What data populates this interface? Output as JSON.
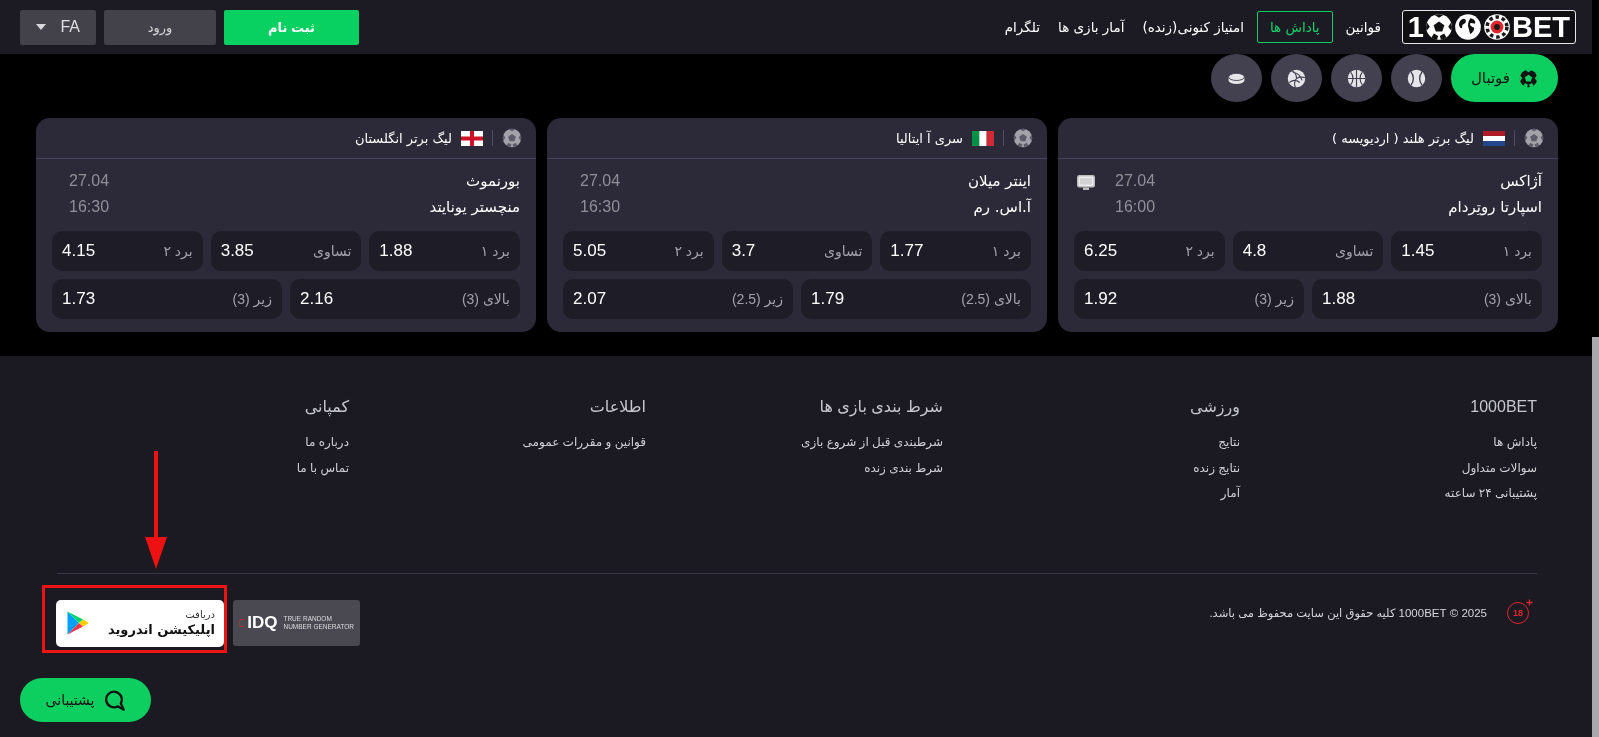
{
  "header": {
    "logo": {
      "lead": "1",
      "tail": "BET"
    },
    "nav": [
      {
        "label": "قوانین",
        "selected": false
      },
      {
        "label": "پاداش ها",
        "selected": true
      },
      {
        "label": "امتیاز کنونی(زنده)",
        "selected": false
      },
      {
        "label": "آمار بازی ها",
        "selected": false
      },
      {
        "label": "تلگرام",
        "selected": false
      }
    ],
    "register": "ثبت نام",
    "login": "ورود",
    "language": "FA"
  },
  "sports": [
    {
      "kind": "football",
      "label": "فوتبال",
      "selected": true
    },
    {
      "kind": "tennis",
      "selected": false
    },
    {
      "kind": "basketball",
      "selected": false
    },
    {
      "kind": "volleyball",
      "selected": false
    },
    {
      "kind": "hockey",
      "selected": false
    }
  ],
  "matches": [
    {
      "league": "لیگ برتر هلند ( اردیویسه )",
      "flag": {
        "kind": "netherlands"
      },
      "teams": [
        "آژاکس",
        "اسپارتا روتِردام"
      ],
      "date": "27.04",
      "time": "16:00",
      "tv": true,
      "odds": [
        {
          "label": "برد ۱",
          "value": "1.45"
        },
        {
          "label": "تساوی",
          "value": "4.8"
        },
        {
          "label": "برد ۲",
          "value": "6.25"
        }
      ],
      "totals": [
        {
          "label": "بالای (3)",
          "value": "1.88"
        },
        {
          "label": "زیر (3)",
          "value": "1.92"
        }
      ]
    },
    {
      "league": "سری آ ایتالیا",
      "flag": {
        "kind": "italy"
      },
      "teams": [
        "اینتر میلان",
        "آ.اس. رم"
      ],
      "date": "27.04",
      "time": "16:30",
      "tv": false,
      "odds": [
        {
          "label": "برد ۱",
          "value": "1.77"
        },
        {
          "label": "تساوی",
          "value": "3.7"
        },
        {
          "label": "برد ۲",
          "value": "5.05"
        }
      ],
      "totals": [
        {
          "label": "بالای (2.5)",
          "value": "1.79"
        },
        {
          "label": "زیر (2.5)",
          "value": "2.07"
        }
      ]
    },
    {
      "league": "لیگ برتر انگلستان",
      "flag": {
        "kind": "england"
      },
      "teams": [
        "بورنموث",
        "منچستر یونایتد"
      ],
      "date": "27.04",
      "time": "16:30",
      "tv": false,
      "odds": [
        {
          "label": "برد ۱",
          "value": "1.88"
        },
        {
          "label": "تساوی",
          "value": "3.85"
        },
        {
          "label": "برد ۲",
          "value": "4.15"
        }
      ],
      "totals": [
        {
          "label": "بالای (3)",
          "value": "2.16"
        },
        {
          "label": "زیر (3)",
          "value": "1.73"
        }
      ]
    }
  ],
  "footer": {
    "columns": [
      {
        "title": "1000BET",
        "links": [
          "پاداش ها",
          "سوالات متداول",
          "پشتیبانی ۲۴ ساعته"
        ]
      },
      {
        "title": "ورزشی",
        "links": [
          "نتایج",
          "نتایج زنده",
          "آمار"
        ]
      },
      {
        "title": "شرط بندی بازی ها",
        "links": [
          "شرطبندی قبل از شروع بازی",
          "شرط بندی زنده"
        ]
      },
      {
        "title": "اطلاعات",
        "links": [
          "قوانین و مقررات عمومی"
        ]
      },
      {
        "title": "کمپانی",
        "links": [
          "درباره ما",
          "تماس با ما"
        ]
      }
    ],
    "app_badge": {
      "caption": "دریافت",
      "title": "اپلیکیشن اندروید"
    },
    "rng_badge": {
      "brand": "IDQ",
      "caption": [
        "TRUE RANDOM",
        "NUMBER GENERATOR"
      ]
    },
    "age_limit": "18",
    "copyright": "2025 © 1000BET کلیه حقوق این سایت محفوظ می باشد.",
    "support": "پشتیبانی"
  },
  "annotations": {
    "arrow_to_app_badge": true,
    "frame_around_app_badge": true
  }
}
